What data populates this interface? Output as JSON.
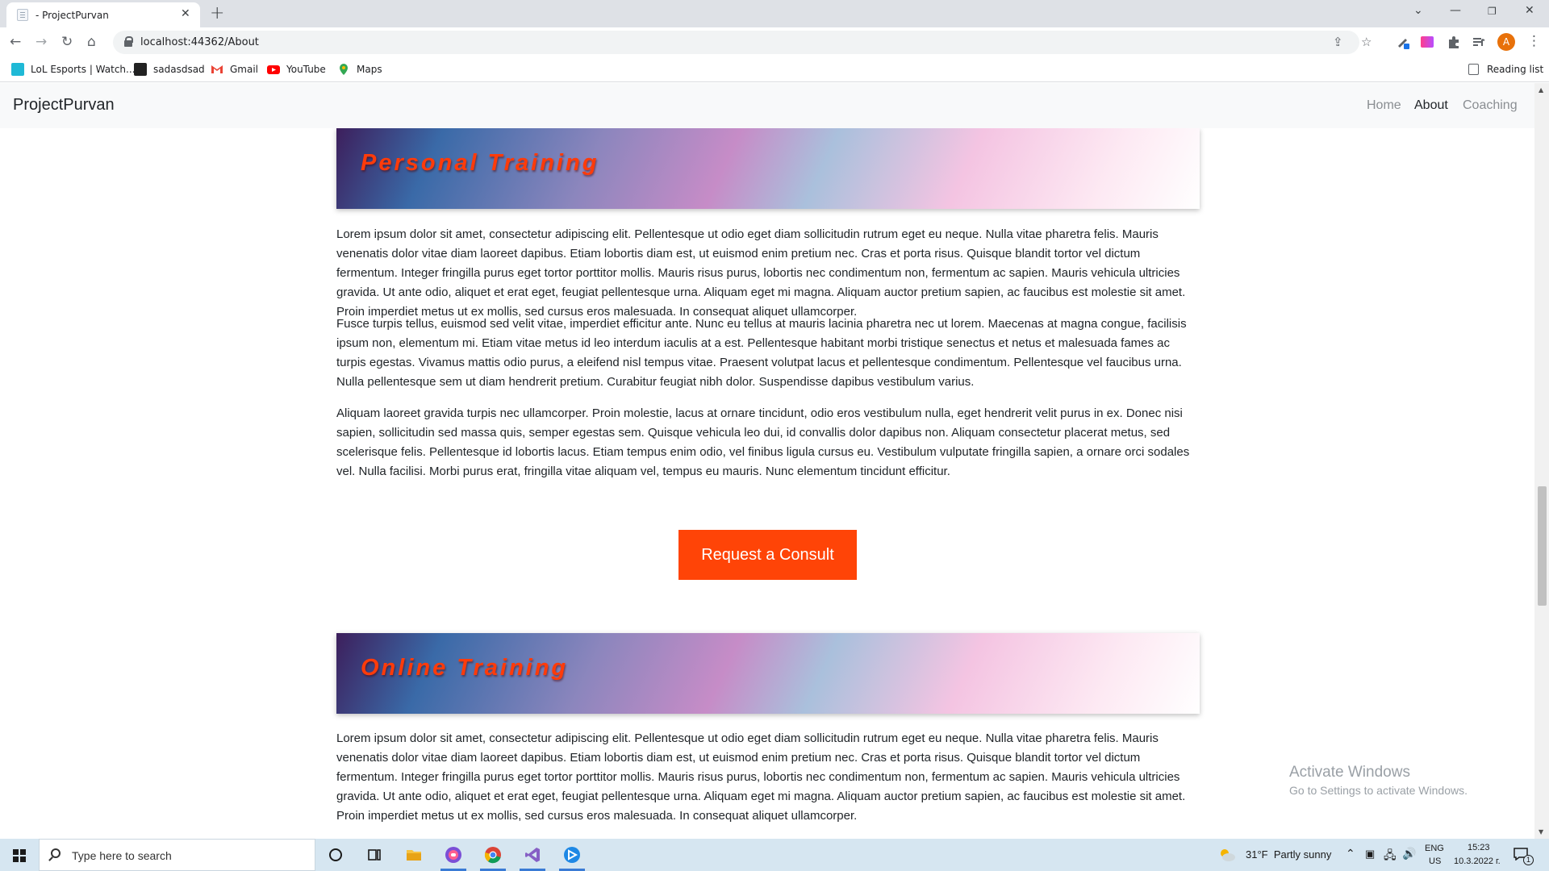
{
  "browser": {
    "tab_title": "- ProjectPurvan",
    "tab_close": "✕",
    "new_tab": "+",
    "url": "localhost:44362/About",
    "profile_initial": "A",
    "reading_list": "Reading list",
    "bookmarks": [
      {
        "label": "LoL Esports | Watch...",
        "icon": "lol-esports-icon"
      },
      {
        "label": "sadasdsad",
        "icon": "ws-icon"
      },
      {
        "label": "Gmail",
        "icon": "gmail-icon"
      },
      {
        "label": "YouTube",
        "icon": "youtube-icon"
      },
      {
        "label": "Maps",
        "icon": "maps-icon"
      }
    ]
  },
  "site": {
    "brand": "ProjectPurvan",
    "nav": [
      {
        "label": "Home",
        "active": false
      },
      {
        "label": "About",
        "active": true
      },
      {
        "label": "Coaching",
        "active": false
      }
    ],
    "sections": [
      {
        "title": "Personal Training",
        "paragraphs": [
          "Lorem ipsum dolor sit amet, consectetur adipiscing elit. Pellentesque ut odio eget diam sollicitudin rutrum eget eu neque. Nulla vitae pharetra felis. Mauris venenatis dolor vitae diam laoreet dapibus. Etiam lobortis diam est, ut euismod enim pretium nec. Cras et porta risus. Quisque blandit tortor vel dictum fermentum. Integer fringilla purus eget tortor porttitor mollis. Mauris risus purus, lobortis nec condimentum non, fermentum ac sapien. Mauris vehicula ultricies gravida. Ut ante odio, aliquet et erat eget, feugiat pellentesque urna. Aliquam eget mi magna. Aliquam auctor pretium sapien, ac faucibus est molestie sit amet. Proin imperdiet metus ut ex mollis, sed cursus eros malesuada. In consequat aliquet ullamcorper.",
          "Fusce turpis tellus, euismod sed velit vitae, imperdiet efficitur ante. Nunc eu tellus at mauris lacinia pharetra nec ut lorem. Maecenas at magna congue, facilisis ipsum non, elementum mi. Etiam vitae metus id leo interdum iaculis at a est. Pellentesque habitant morbi tristique senectus et netus et malesuada fames ac turpis egestas. Vivamus mattis odio purus, a eleifend nisl tempus vitae. Praesent volutpat lacus et pellentesque condimentum. Pellentesque vel faucibus urna. Nulla pellentesque sem ut diam hendrerit pretium. Curabitur feugiat nibh dolor. Suspendisse dapibus vestibulum varius.",
          "Aliquam laoreet gravida turpis nec ullamcorper. Proin molestie, lacus at ornare tincidunt, odio eros vestibulum nulla, eget hendrerit velit purus in ex. Donec nisi sapien, sollicitudin sed massa quis, semper egestas sem. Quisque vehicula leo dui, id convallis dolor dapibus non. Aliquam consectetur placerat metus, sed scelerisque felis. Pellentesque id lobortis lacus. Etiam tempus enim odio, vel finibus ligula cursus eu. Vestibulum vulputate fringilla sapien, a ornare orci sodales vel. Nulla facilisi. Morbi purus erat, fringilla vitae aliquam vel, tempus eu mauris. Nunc elementum tincidunt efficitur."
        ],
        "button": "Request a Consult"
      },
      {
        "title": "Online Training",
        "paragraphs": [
          "Lorem ipsum dolor sit amet, consectetur adipiscing elit. Pellentesque ut odio eget diam sollicitudin rutrum eget eu neque. Nulla vitae pharetra felis. Mauris venenatis dolor vitae diam laoreet dapibus. Etiam lobortis diam est, ut euismod enim pretium nec. Cras et porta risus. Quisque blandit tortor vel dictum fermentum. Integer fringilla purus eget tortor porttitor mollis. Mauris risus purus, lobortis nec condimentum non, fermentum ac sapien. Mauris vehicula ultricies gravida. Ut ante odio, aliquet et erat eget, feugiat pellentesque urna. Aliquam eget mi magna. Aliquam auctor pretium sapien, ac faucibus est molestie sit amet. Proin imperdiet metus ut ex mollis, sed cursus eros malesuada. In consequat aliquet ullamcorper."
        ]
      }
    ],
    "activate_windows": {
      "title": "Activate Windows",
      "subtitle": "Go to Settings to activate Windows."
    }
  },
  "taskbar": {
    "search_placeholder": "Type here to search",
    "weather": "31°F  Partly sunny",
    "lang_top": "ENG",
    "lang_bottom": "US",
    "time": "15:23",
    "date": "10.3.2022 г.",
    "notification_count": "1"
  },
  "colors": {
    "accent": "#ff4407",
    "banner_title": "#ff3b0a",
    "navbar_bg": "#f8f9fa"
  }
}
